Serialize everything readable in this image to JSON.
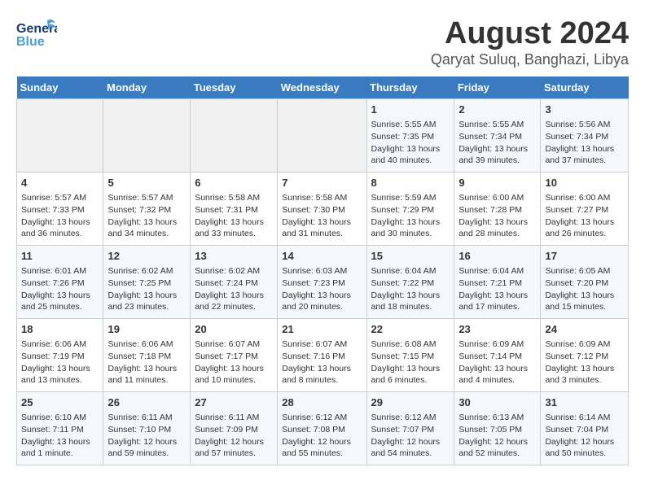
{
  "header": {
    "logo_general": "General",
    "logo_blue": "Blue",
    "month": "August 2024",
    "location": "Qaryat Suluq, Banghazi, Libya"
  },
  "days_of_week": [
    "Sunday",
    "Monday",
    "Tuesday",
    "Wednesday",
    "Thursday",
    "Friday",
    "Saturday"
  ],
  "weeks": [
    [
      {
        "day": "",
        "info": ""
      },
      {
        "day": "",
        "info": ""
      },
      {
        "day": "",
        "info": ""
      },
      {
        "day": "",
        "info": ""
      },
      {
        "day": "1",
        "info": "Sunrise: 5:55 AM\nSunset: 7:35 PM\nDaylight: 13 hours\nand 40 minutes."
      },
      {
        "day": "2",
        "info": "Sunrise: 5:55 AM\nSunset: 7:34 PM\nDaylight: 13 hours\nand 39 minutes."
      },
      {
        "day": "3",
        "info": "Sunrise: 5:56 AM\nSunset: 7:34 PM\nDaylight: 13 hours\nand 37 minutes."
      }
    ],
    [
      {
        "day": "4",
        "info": "Sunrise: 5:57 AM\nSunset: 7:33 PM\nDaylight: 13 hours\nand 36 minutes."
      },
      {
        "day": "5",
        "info": "Sunrise: 5:57 AM\nSunset: 7:32 PM\nDaylight: 13 hours\nand 34 minutes."
      },
      {
        "day": "6",
        "info": "Sunrise: 5:58 AM\nSunset: 7:31 PM\nDaylight: 13 hours\nand 33 minutes."
      },
      {
        "day": "7",
        "info": "Sunrise: 5:58 AM\nSunset: 7:30 PM\nDaylight: 13 hours\nand 31 minutes."
      },
      {
        "day": "8",
        "info": "Sunrise: 5:59 AM\nSunset: 7:29 PM\nDaylight: 13 hours\nand 30 minutes."
      },
      {
        "day": "9",
        "info": "Sunrise: 6:00 AM\nSunset: 7:28 PM\nDaylight: 13 hours\nand 28 minutes."
      },
      {
        "day": "10",
        "info": "Sunrise: 6:00 AM\nSunset: 7:27 PM\nDaylight: 13 hours\nand 26 minutes."
      }
    ],
    [
      {
        "day": "11",
        "info": "Sunrise: 6:01 AM\nSunset: 7:26 PM\nDaylight: 13 hours\nand 25 minutes."
      },
      {
        "day": "12",
        "info": "Sunrise: 6:02 AM\nSunset: 7:25 PM\nDaylight: 13 hours\nand 23 minutes."
      },
      {
        "day": "13",
        "info": "Sunrise: 6:02 AM\nSunset: 7:24 PM\nDaylight: 13 hours\nand 22 minutes."
      },
      {
        "day": "14",
        "info": "Sunrise: 6:03 AM\nSunset: 7:23 PM\nDaylight: 13 hours\nand 20 minutes."
      },
      {
        "day": "15",
        "info": "Sunrise: 6:04 AM\nSunset: 7:22 PM\nDaylight: 13 hours\nand 18 minutes."
      },
      {
        "day": "16",
        "info": "Sunrise: 6:04 AM\nSunset: 7:21 PM\nDaylight: 13 hours\nand 17 minutes."
      },
      {
        "day": "17",
        "info": "Sunrise: 6:05 AM\nSunset: 7:20 PM\nDaylight: 13 hours\nand 15 minutes."
      }
    ],
    [
      {
        "day": "18",
        "info": "Sunrise: 6:06 AM\nSunset: 7:19 PM\nDaylight: 13 hours\nand 13 minutes."
      },
      {
        "day": "19",
        "info": "Sunrise: 6:06 AM\nSunset: 7:18 PM\nDaylight: 13 hours\nand 11 minutes."
      },
      {
        "day": "20",
        "info": "Sunrise: 6:07 AM\nSunset: 7:17 PM\nDaylight: 13 hours\nand 10 minutes."
      },
      {
        "day": "21",
        "info": "Sunrise: 6:07 AM\nSunset: 7:16 PM\nDaylight: 13 hours\nand 8 minutes."
      },
      {
        "day": "22",
        "info": "Sunrise: 6:08 AM\nSunset: 7:15 PM\nDaylight: 13 hours\nand 6 minutes."
      },
      {
        "day": "23",
        "info": "Sunrise: 6:09 AM\nSunset: 7:14 PM\nDaylight: 13 hours\nand 4 minutes."
      },
      {
        "day": "24",
        "info": "Sunrise: 6:09 AM\nSunset: 7:12 PM\nDaylight: 13 hours\nand 3 minutes."
      }
    ],
    [
      {
        "day": "25",
        "info": "Sunrise: 6:10 AM\nSunset: 7:11 PM\nDaylight: 13 hours\nand 1 minute."
      },
      {
        "day": "26",
        "info": "Sunrise: 6:11 AM\nSunset: 7:10 PM\nDaylight: 12 hours\nand 59 minutes."
      },
      {
        "day": "27",
        "info": "Sunrise: 6:11 AM\nSunset: 7:09 PM\nDaylight: 12 hours\nand 57 minutes."
      },
      {
        "day": "28",
        "info": "Sunrise: 6:12 AM\nSunset: 7:08 PM\nDaylight: 12 hours\nand 55 minutes."
      },
      {
        "day": "29",
        "info": "Sunrise: 6:12 AM\nSunset: 7:07 PM\nDaylight: 12 hours\nand 54 minutes."
      },
      {
        "day": "30",
        "info": "Sunrise: 6:13 AM\nSunset: 7:05 PM\nDaylight: 12 hours\nand 52 minutes."
      },
      {
        "day": "31",
        "info": "Sunrise: 6:14 AM\nSunset: 7:04 PM\nDaylight: 12 hours\nand 50 minutes."
      }
    ]
  ]
}
